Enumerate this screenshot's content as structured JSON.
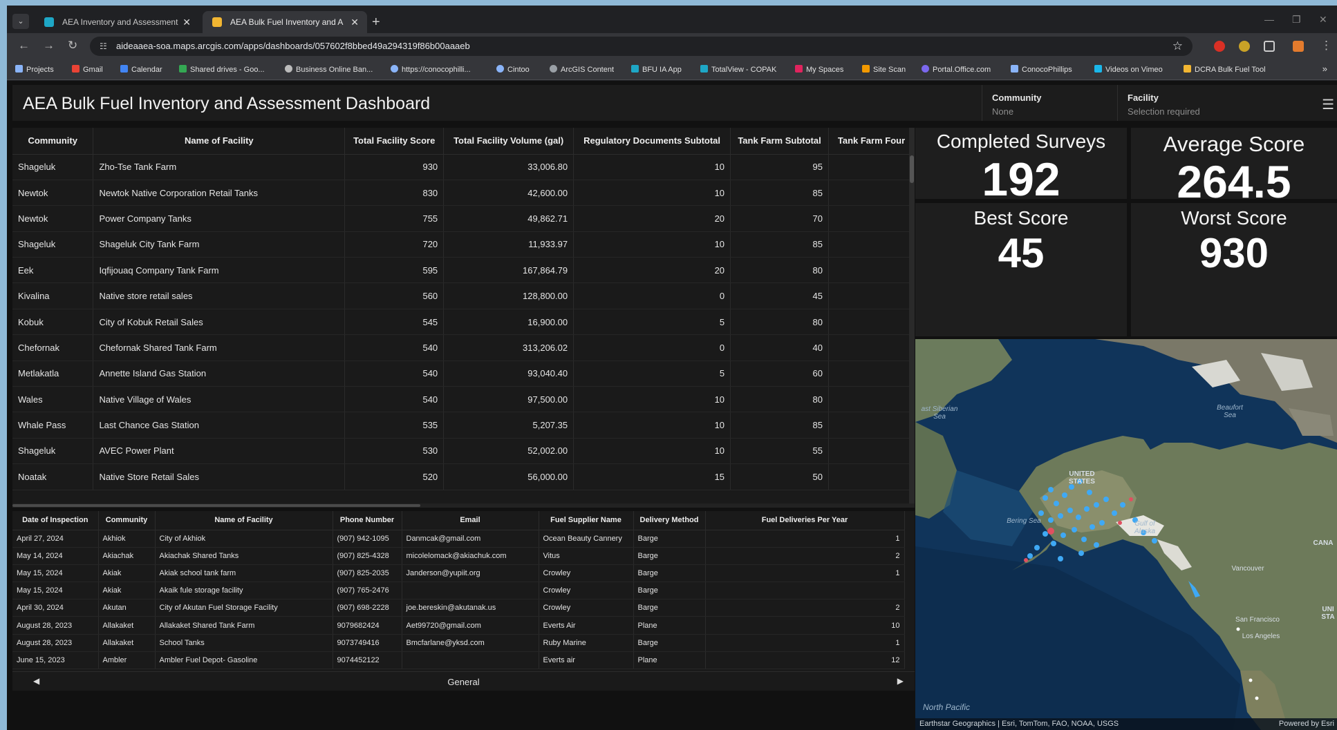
{
  "browser": {
    "tabs": [
      {
        "title": "AEA Inventory and Assessment"
      },
      {
        "title": "AEA Bulk Fuel Inventory and A"
      }
    ],
    "url": "aideaaea-soa.maps.arcgis.com/apps/dashboards/057602f8bbed49a294319f86b00aaaeb",
    "bookmarks": [
      "Projects",
      "Gmail",
      "Calendar",
      "Shared drives - Goo...",
      "Business Online Ban...",
      "https://conocophilli...",
      "Cintoo",
      "ArcGIS Content",
      "BFU IA App",
      "TotalView - COPAK",
      "My Spaces",
      "Site Scan",
      "Portal.Office.com",
      "ConocoPhillips",
      "Videos on Vimeo",
      "DCRA Bulk Fuel Tool"
    ]
  },
  "dashboard": {
    "title": "AEA Bulk Fuel Inventory and Assessment Dashboard",
    "community_selector": {
      "label": "Community",
      "value": "None"
    },
    "facility_selector": {
      "label": "Facility",
      "value": "Selection required"
    }
  },
  "facility_table": {
    "headers": [
      "Community",
      "Name of Facility",
      "Total Facility Score",
      "Total Facility Volume (gal)",
      "Regulatory Documents Subtotal",
      "Tank Farm Subtotal",
      "Tank Farm Four"
    ],
    "rows": [
      [
        "Shageluk",
        "Zho-Tse Tank Farm",
        "930",
        "33,006.80",
        "10",
        "95",
        ""
      ],
      [
        "Newtok",
        "Newtok Native Corporation Retail Tanks",
        "830",
        "42,600.00",
        "10",
        "85",
        ""
      ],
      [
        "Newtok",
        "Power Company Tanks",
        "755",
        "49,862.71",
        "20",
        "70",
        ""
      ],
      [
        "Shageluk",
        "Shageluk City Tank Farm",
        "720",
        "11,933.97",
        "10",
        "85",
        ""
      ],
      [
        "Eek",
        "Iqfijouaq Company Tank Farm",
        "595",
        "167,864.79",
        "20",
        "80",
        ""
      ],
      [
        "Kivalina",
        "Native store retail sales",
        "560",
        "128,800.00",
        "0",
        "45",
        ""
      ],
      [
        "Kobuk",
        "City of Kobuk Retail Sales",
        "545",
        "16,900.00",
        "5",
        "80",
        ""
      ],
      [
        "Chefornak",
        "Chefornak Shared Tank Farm",
        "540",
        "313,206.02",
        "0",
        "40",
        ""
      ],
      [
        "Metlakatla",
        "Annette Island Gas Station",
        "540",
        "93,040.40",
        "5",
        "60",
        ""
      ],
      [
        "Wales",
        "Native Village of Wales",
        "540",
        "97,500.00",
        "10",
        "80",
        ""
      ],
      [
        "Whale Pass",
        "Last Chance Gas Station",
        "535",
        "5,207.35",
        "10",
        "85",
        ""
      ],
      [
        "Shageluk",
        "AVEC Power Plant",
        "530",
        "52,002.00",
        "10",
        "55",
        ""
      ],
      [
        "Noatak",
        "Native Store Retail Sales",
        "520",
        "56,000.00",
        "15",
        "50",
        ""
      ]
    ]
  },
  "inspection_table": {
    "headers": [
      "Date of Inspection",
      "Community",
      "Name of Facility",
      "Phone Number",
      "Email",
      "Fuel Supplier Name",
      "Delivery Method",
      "Fuel Deliveries Per Year"
    ],
    "rows": [
      [
        "April 27, 2024",
        "Akhiok",
        "City of Akhiok",
        "(907) 942-1095",
        "Danmcak@gmail.com",
        "Ocean Beauty Cannery",
        "Barge",
        "1"
      ],
      [
        "May 14, 2024",
        "Akiachak",
        "Akiachak Shared Tanks",
        "(907) 825-4328",
        "micolelomack@akiachuk.com",
        "Vitus",
        "Barge",
        "2"
      ],
      [
        "May 15, 2024",
        "Akiak",
        "Akiak school tank farm",
        "(907) 825-2035",
        "Janderson@yupiit.org",
        "Crowley",
        "Barge",
        "1"
      ],
      [
        "May 15, 2024",
        "Akiak",
        "Akaik fule storage facility",
        "(907) 765-2476",
        "",
        "Crowley",
        "Barge",
        ""
      ],
      [
        "April 30, 2024",
        "Akutan",
        "City of Akutan Fuel Storage Facility",
        "(907) 698-2228",
        "joe.bereskin@akutanak.us",
        "Crowley",
        "Barge",
        "2"
      ],
      [
        "August 28, 2023",
        "Allakaket",
        "Allakaket Shared Tank Farm",
        "9079682424",
        "Aet99720@gmail.com",
        "Everts Air",
        "Plane",
        "10"
      ],
      [
        "August 28, 2023",
        "Allakaket",
        "School Tanks",
        "9073749416",
        "Bmcfarlane@yksd.com",
        "Ruby Marine",
        "Barge",
        "1"
      ],
      [
        "June 15, 2023",
        "Ambler",
        "Ambler Fuel Depot- Gasoline",
        "9074452122",
        "",
        "Everts air",
        "Plane",
        "12"
      ]
    ],
    "pager_label": "General"
  },
  "stats": {
    "completed": {
      "title": "Completed Surveys",
      "value": "192"
    },
    "average": {
      "title": "Average Score",
      "value": "264.5"
    },
    "best": {
      "title": "Best Score",
      "value": "45"
    },
    "worst": {
      "title": "Worst Score",
      "value": "930"
    }
  },
  "map": {
    "labels": {
      "east_siberian": "ast Siberian\nSea",
      "beaufort": "Beaufort\nSea",
      "united_states": "UNITED\nSTATES",
      "bering": "Bering Sea",
      "gulf": "Gulf of\nAlaska",
      "canada": "CANA",
      "vancouver": "Vancouver",
      "san_francisco": "San Francisco",
      "los_angeles": "Los Angeles",
      "north_pacific": "North Pacific",
      "united_states_2": "UNI\nSTA"
    },
    "attribution": "Earthstar Geographics | Esri, TomTom, FAO, NOAA, USGS",
    "powered_by": "Powered by Esri"
  },
  "colors": {
    "dashboard_bg": "#111111",
    "panel_bg": "#1a1a1a",
    "facility_point": "#3fa9f5",
    "facility_point_alert": "#e05060"
  }
}
